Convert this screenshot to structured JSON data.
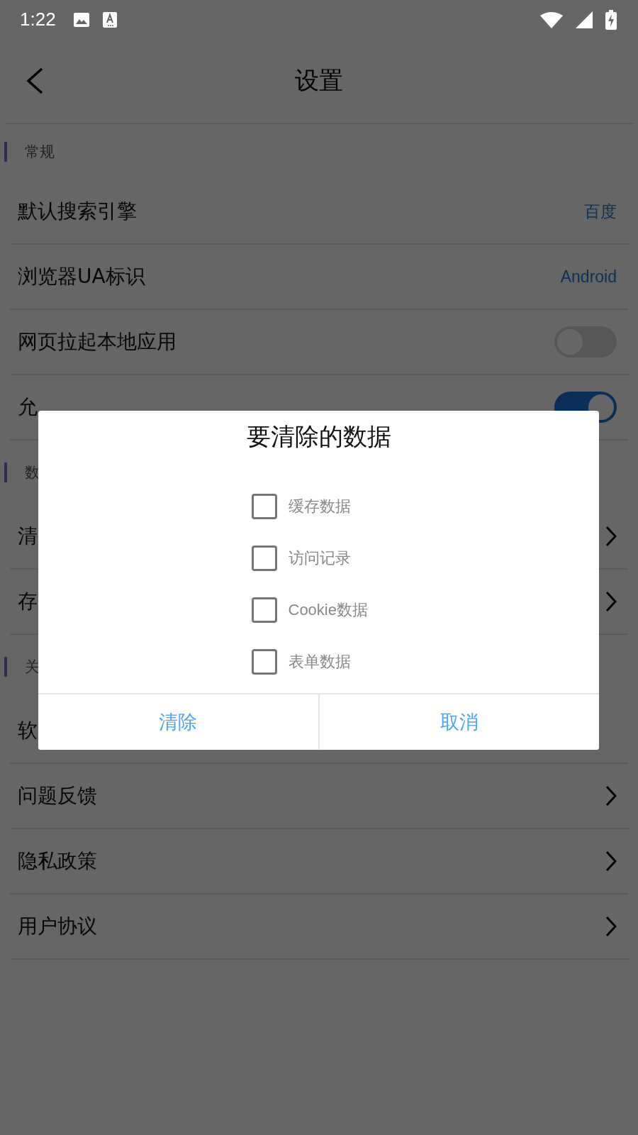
{
  "status_bar": {
    "time": "1:22"
  },
  "header": {
    "title": "设置"
  },
  "sections": [
    {
      "title": "常规",
      "rows": [
        {
          "kind": "value",
          "label": "默认搜索引擎",
          "value": "百度"
        },
        {
          "kind": "value",
          "label": "浏览器UA标识",
          "value": "Android"
        },
        {
          "kind": "switch",
          "label": "网页拉起本地应用",
          "on": false
        },
        {
          "kind": "switch",
          "label": "允",
          "on": true
        }
      ]
    },
    {
      "title": "数",
      "rows": [
        {
          "kind": "link",
          "label": "清"
        },
        {
          "kind": "link",
          "label": "存"
        }
      ]
    },
    {
      "title": "关",
      "rows": [
        {
          "kind": "plain",
          "label": "软"
        },
        {
          "kind": "link",
          "label": "问题反馈"
        },
        {
          "kind": "link",
          "label": "隐私政策"
        },
        {
          "kind": "link",
          "label": "用户协议"
        }
      ]
    }
  ],
  "dialog": {
    "title": "要清除的数据",
    "options": [
      {
        "label": "缓存数据",
        "checked": false
      },
      {
        "label": "访问记录",
        "checked": false
      },
      {
        "label": "Cookie数据",
        "checked": false
      },
      {
        "label": "表单数据",
        "checked": false
      }
    ],
    "buttons": [
      "清除",
      "取消"
    ]
  }
}
